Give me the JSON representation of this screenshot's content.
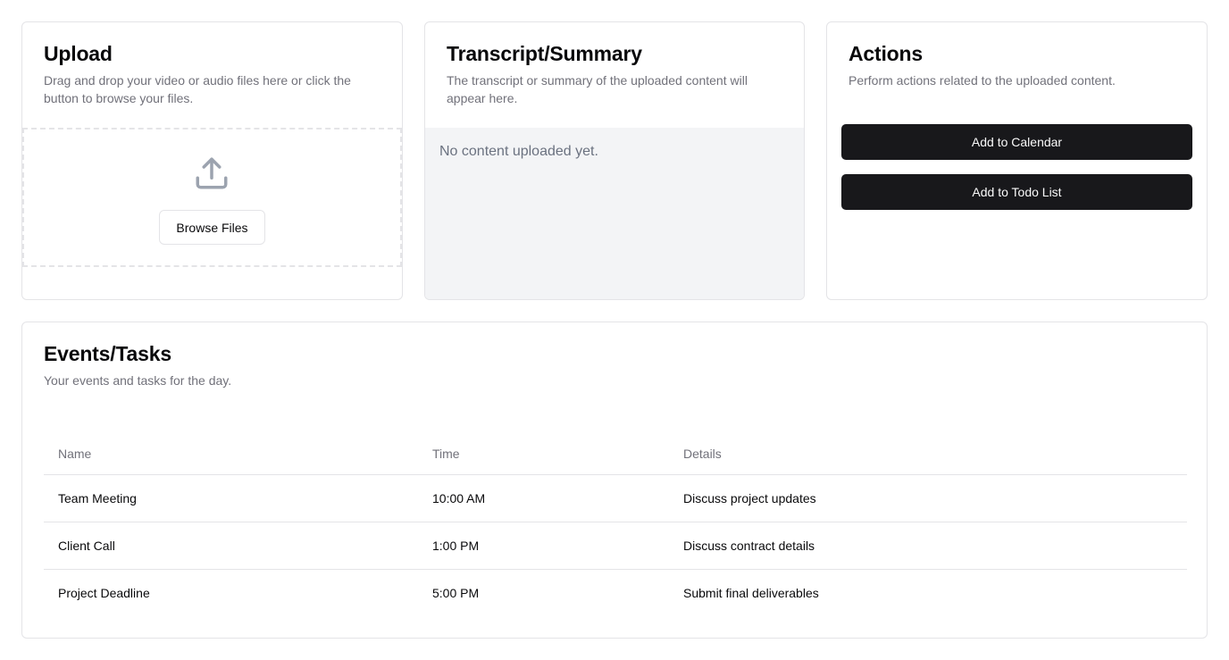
{
  "upload": {
    "title": "Upload",
    "description": "Drag and drop your video or audio files here or click the button to browse your files.",
    "icon": "upload-icon",
    "browse_label": "Browse Files"
  },
  "transcript": {
    "title": "Transcript/Summary",
    "description": "The transcript or summary of the uploaded content will appear here.",
    "empty_text": "No content uploaded yet."
  },
  "actions": {
    "title": "Actions",
    "description": "Perform actions related to the uploaded content.",
    "calendar_label": "Add to Calendar",
    "todo_label": "Add to Todo List"
  },
  "events": {
    "title": "Events/Tasks",
    "description": "Your events and tasks for the day.",
    "columns": [
      "Name",
      "Time",
      "Details"
    ],
    "rows": [
      {
        "name": "Team Meeting",
        "time": "10:00 AM",
        "details": "Discuss project updates"
      },
      {
        "name": "Client Call",
        "time": "1:00 PM",
        "details": "Discuss contract details"
      },
      {
        "name": "Project Deadline",
        "time": "5:00 PM",
        "details": "Submit final deliverables"
      }
    ]
  },
  "colors": {
    "primary_button": "#18181b",
    "muted_text": "#71717a",
    "border": "#e4e4e7",
    "transcript_bg": "#f3f4f6"
  }
}
